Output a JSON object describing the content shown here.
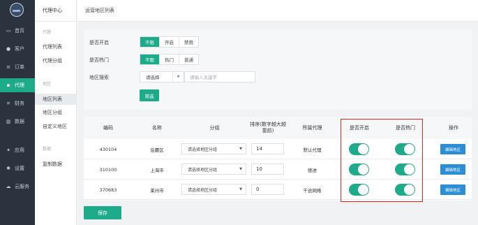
{
  "sidebar": {
    "items": [
      {
        "label": "首页",
        "icon": "monitor-icon",
        "glyph": "▭"
      },
      {
        "label": "客户",
        "icon": "user-icon",
        "glyph": "●"
      },
      {
        "label": "订单",
        "icon": "list-icon",
        "glyph": "≡"
      },
      {
        "label": "代理",
        "icon": "book-icon",
        "glyph": "▪"
      },
      {
        "label": "财务",
        "icon": "finance-icon",
        "glyph": "¤"
      },
      {
        "label": "数据",
        "icon": "chart-icon",
        "glyph": "▥"
      },
      {
        "label": "应用",
        "icon": "apps-icon",
        "glyph": "✦"
      },
      {
        "label": "设置",
        "icon": "gear-icon",
        "glyph": "✱"
      },
      {
        "label": "云服务",
        "icon": "cloud-icon",
        "glyph": "☁"
      }
    ],
    "active_index": 3
  },
  "subnav": {
    "title": "代理中心",
    "group1": "代理",
    "item_agent_list": "代理列表",
    "item_agent_group": "代理分组",
    "group2": "地区",
    "item_region_list": "地区列表",
    "item_region_group": "地区分组",
    "item_custom_region": "自定义地区",
    "group3": "数据",
    "item_copy_data": "复制数据"
  },
  "breadcrumb": "运营地区列表",
  "filter": {
    "open_label": "是否开启",
    "open_options": [
      "不限",
      "开启",
      "禁用"
    ],
    "hot_label": "是否热门",
    "hot_options": [
      "不限",
      "热门",
      "普通"
    ],
    "search_label": "地区搜索",
    "select_value": "请选择",
    "keyword_placeholder": "请输入关键字",
    "filter_button": "筛选"
  },
  "table": {
    "headers": {
      "code": "编码",
      "name": "名称",
      "group": "分组",
      "sort": "排序(数字越大越靠前)",
      "agent": "所属代理",
      "open": "是否开启",
      "hot": "是否热门",
      "action": "操作"
    },
    "rows": [
      {
        "code": "430104",
        "name": "岳麓区",
        "group": "请选择地区分组",
        "sort": "14",
        "agent": "默认代理",
        "open": true,
        "hot": true,
        "action": "编辑地区"
      },
      {
        "code": "310100",
        "name": "上海市",
        "group": "请选择地区分组",
        "sort": "10",
        "agent": "德进",
        "open": true,
        "hot": true,
        "action": "编辑地区"
      },
      {
        "code": "370683",
        "name": "莱州市",
        "group": "请选择地区分组",
        "sort": "0",
        "agent": "千途网络",
        "open": true,
        "hot": true,
        "action": "编辑地区"
      }
    ]
  },
  "save_button": "保存",
  "colors": {
    "primary": "#1eab8a",
    "sidebar": "#2b333f",
    "edit": "#2c8fd6",
    "highlight": "#e1251b"
  }
}
